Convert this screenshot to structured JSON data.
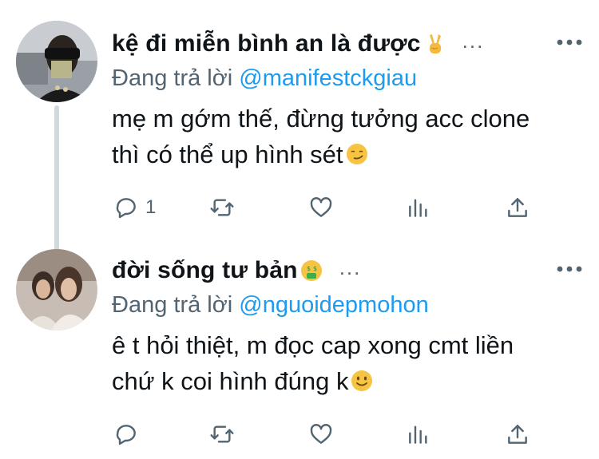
{
  "tweets": [
    {
      "display_name": "kệ đi miễn bình an là được",
      "name_emoji": "victory-hand-emoji",
      "reply_prefix": "Đang trả lời",
      "reply_handle": "@manifestckgiau",
      "body_lines": [
        "mẹ m gớm thế, đừng tưởng acc clone",
        "thì có thể up hình sét"
      ],
      "body_emoji": "smirking-face-emoji",
      "reply_count": "1",
      "more_dots": "..."
    },
    {
      "display_name": "đời sống tư bản",
      "name_emoji": "money-mouth-face-emoji",
      "reply_prefix": "Đang trả lời",
      "reply_handle": "@nguoidepmohon",
      "body_lines": [
        "ê t hỏi thiệt, m đọc cap xong cmt liền",
        "chứ k coi hình đúng k"
      ],
      "body_emoji": "slightly-smiling-face-emoji",
      "reply_count": "",
      "more_dots": "..."
    }
  ],
  "colors": {
    "text": "#0f1419",
    "secondary": "#536471",
    "link": "#1d9bf0",
    "thread_line": "#cfd9de"
  },
  "icons": [
    "reply-icon",
    "retweet-icon",
    "like-icon",
    "analytics-icon",
    "share-icon",
    "more-icon"
  ]
}
